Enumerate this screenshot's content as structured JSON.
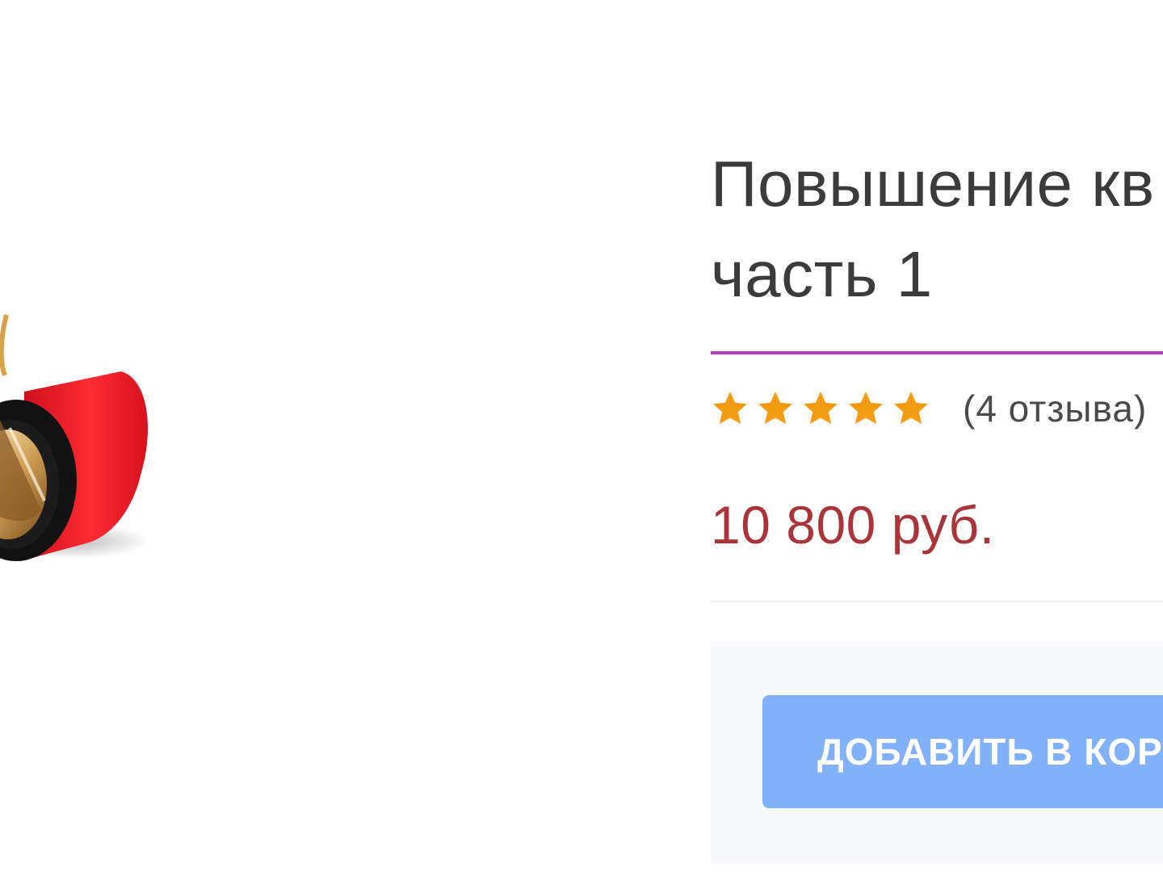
{
  "product": {
    "title": "Повышение кв\nчасть 1",
    "rating_stars": 5,
    "reviews_text": "(4 отзыва)",
    "price": "10 800 руб.",
    "add_to_cart_label": "ДОБАВИТЬ В КОРЗ",
    "image_icon": "adhesive-tape-roll-icon"
  },
  "colors": {
    "title_text": "#3b3b3b",
    "divider_accent": "#b43fbf",
    "star": "#f39c12",
    "price": "#a9343a",
    "button_bg": "#82b1fa",
    "button_text": "#ffffff"
  }
}
